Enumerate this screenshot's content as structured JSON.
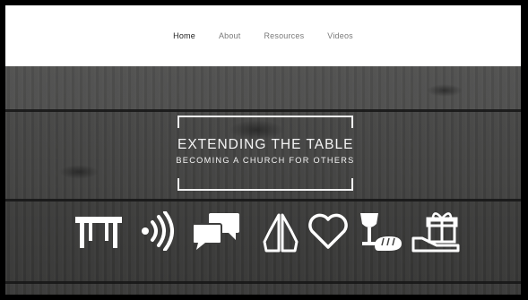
{
  "nav": {
    "items": [
      {
        "label": "Home",
        "active": true
      },
      {
        "label": "About",
        "active": false
      },
      {
        "label": "Resources",
        "active": false
      },
      {
        "label": "Videos",
        "active": false
      }
    ]
  },
  "hero": {
    "title": "EXTENDING THE TABLE",
    "subtitle": "BECOMING A CHURCH FOR OTHERS",
    "icons": [
      "table-icon",
      "sound-waves-icon",
      "chat-bubbles-icon",
      "praying-hands-icon",
      "heart-icon",
      "chalice-bread-icon",
      "gift-hand-icon"
    ]
  },
  "colors": {
    "nav_background": "#ffffff",
    "nav_active_text": "#222222",
    "nav_text": "#7a7a7a",
    "wood_dark": "#3a3a39",
    "hero_text": "#f4f4f4"
  }
}
